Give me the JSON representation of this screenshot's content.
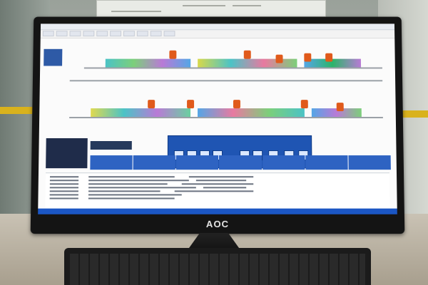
{
  "photo": {
    "monitor_brand": "AOC"
  },
  "colors": {
    "screen_bg": "#fbfbfb",
    "accent_blue": "#1f55b3",
    "tower_orange": "#e05a1b",
    "stripe_yellow": "#d9b21d"
  }
}
